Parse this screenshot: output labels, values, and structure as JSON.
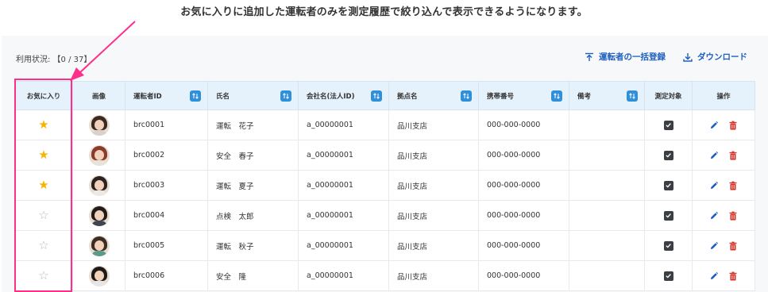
{
  "caption": "お気に入りに追加した運転者のみを測定履歴で絞り込んで表示できるようになります。",
  "usage": "利用状況: 【0 / 37】",
  "actions": {
    "bulk_register": "運転者の一括登録",
    "download": "ダウンロード"
  },
  "columns": {
    "favorite": "お気に入り",
    "image": "画像",
    "driver_id": "運転者ID",
    "name": "氏名",
    "company": "会社名(法人ID)",
    "base": "拠点名",
    "phone": "携帯番号",
    "note": "備考",
    "target": "測定対象",
    "operation": "操作"
  },
  "rows": [
    {
      "favorite": true,
      "driver_id": "brc0001",
      "name": "運転　花子",
      "company": "a_00000001",
      "base": "品川支店",
      "phone": "000-000-0000",
      "note": "",
      "target": true,
      "avatar": {
        "hair": "#3a2a22",
        "body": "#d9d2cc"
      }
    },
    {
      "favorite": true,
      "driver_id": "brc0002",
      "name": "安全　春子",
      "company": "a_00000001",
      "base": "品川支店",
      "phone": "000-000-0000",
      "note": "",
      "target": true,
      "avatar": {
        "hair": "#8a3b2a",
        "body": "#e8e2dc"
      }
    },
    {
      "favorite": true,
      "driver_id": "brc0003",
      "name": "運転　夏子",
      "company": "a_00000001",
      "base": "品川支店",
      "phone": "000-000-0000",
      "note": "",
      "target": true,
      "avatar": {
        "hair": "#2a2320",
        "body": "#ece8e4"
      }
    },
    {
      "favorite": false,
      "driver_id": "brc0004",
      "name": "点検　太郎",
      "company": "a_00000001",
      "base": "品川支店",
      "phone": "000-000-0000",
      "note": "",
      "target": true,
      "avatar": {
        "hair": "#1f1c1b",
        "body": "#3f4650"
      }
    },
    {
      "favorite": false,
      "driver_id": "brc0005",
      "name": "運転　秋子",
      "company": "a_00000001",
      "base": "品川支店",
      "phone": "000-000-0000",
      "note": "",
      "target": true,
      "avatar": {
        "hair": "#3b2c24",
        "body": "#5d9a8c"
      }
    },
    {
      "favorite": false,
      "driver_id": "brc0006",
      "name": "安全　隆",
      "company": "a_00000001",
      "base": "品川支店",
      "phone": "000-000-0000",
      "note": "",
      "target": true,
      "avatar": {
        "hair": "#1d1a19",
        "body": "#e6e6e6"
      }
    }
  ],
  "colors": {
    "accent": "#1d5fbf",
    "sort_button": "#2f8fd9",
    "header_bg": "#e6f2fb",
    "star_on": "#f5b400",
    "highlight": "#ff2e8a",
    "delete": "#d93025"
  },
  "icons": {
    "upload": "upload-icon",
    "download": "download-icon",
    "sort": "sort-icon",
    "star": "star-icon",
    "edit": "pencil-icon",
    "delete": "trash-icon",
    "checkbox": "checkbox-checked-icon"
  }
}
